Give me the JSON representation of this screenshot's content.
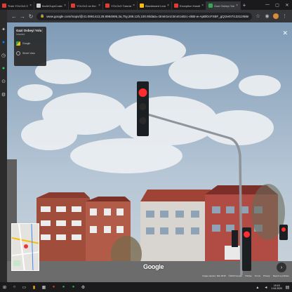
{
  "browser": {
    "tabs": [
      {
        "label": "Train YOLOv3 Custom",
        "color": "#e53935",
        "active": false
      },
      {
        "label": "theAIGuysCode/YOLOv3",
        "color": "#cfcfcf",
        "active": false
      },
      {
        "label": "YOLOv3 on the COCO",
        "color": "#e53935",
        "active": false
      },
      {
        "label": "YOLOv3 Tutorial (pytorch)",
        "color": "#e53935",
        "active": false
      },
      {
        "label": "Blackboard Learn",
        "color": "#fbbc05",
        "active": false
      },
      {
        "label": "Exception Handling",
        "color": "#e53935",
        "active": false
      },
      {
        "label": "Gazi Osbeyi Yolu - Goo",
        "color": "#34a853",
        "active": true
      }
    ],
    "url": "www.google.com/maps/@41.0991413,28.8984995,3a,75y,289.12h,100.9t/data=!3m6!1e1!3m4!1sBzc-4ktB-w-ApBlOcFXBF_gQ!2e0!7i13312!8i6656",
    "new_tab": "+"
  },
  "location_card": {
    "title": "Gazi Osbeyi Yolu",
    "subtitle": "İstanbul",
    "google_link": "Google",
    "street_view_link": "Street View"
  },
  "street_view": {
    "google_logo": "Google",
    "footer": [
      "Image capture: Mar 2018",
      "©2020 Google",
      "Türkiye",
      "Terms",
      "Privacy",
      "Report a problem"
    ]
  },
  "taskbar": {
    "time": "19:19",
    "date": "1.04.2020"
  },
  "colors": {
    "sky": "#9fb7cc",
    "building_brick": "#9b4a3d",
    "traffic_light_red": "#ff2e2e"
  }
}
